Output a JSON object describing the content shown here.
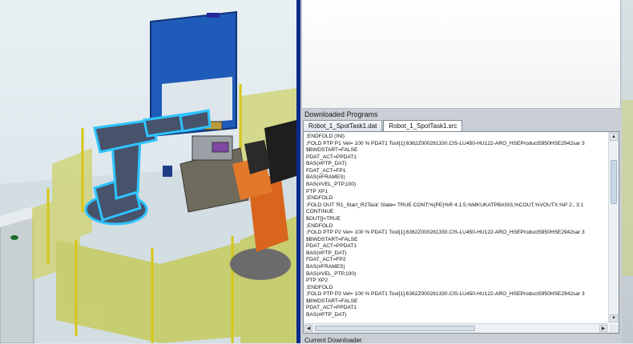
{
  "downloaded": {
    "title": "Downloaded Programs",
    "tabs": [
      "Robot_1_SpotTask1.dat",
      "Robot_1_SpotTask1.src"
    ],
    "active_tab": 1,
    "lines": [
      ";ENDFOLD (INI)",
      ";FOLD PTP P1 Vel= 100 % PDAT1 Tool[1]:6362Z000281330.CIS-LU450-HU122-ARO_HSEProduct5950HSE2942sar 3",
      "$BWDSTART=FALSE",
      "PDAT_ACT=PPDAT1",
      "BAS(#PTP_DAT)",
      "FDAT_ACT=FP1",
      "BAS(#FRAMES)",
      "BAS(#VEL_PTP,100)",
      "PTP XP1",
      ";ENDFOLD",
      ";FOLD OUT 'R1_Start_R2Task' State= TRUE CONT;%{PE}%R 4.1.5,%MKUKATPBASIS,%COUT,%VOUTX,%P 2:, 3:1",
      "CONTINUE",
      "$OUT[]=TRUE",
      ";ENDFOLD",
      ";FOLD PTP P2 Vel= 100 % PDAT1 Tool[1]:6362Z000281330.CIS-LU450-HU122-ARO_HSEProduct5950HSE2942sar 3",
      "$BWDSTART=FALSE",
      "PDAT_ACT=PPDAT1",
      "BAS(#PTP_DAT)",
      "FDAT_ACT=FP2",
      "BAS(#FRAMES)",
      "BAS(#VEL_PTP,100)",
      "PTP XP2",
      ";ENDFOLD",
      ";FOLD PTP P3 Vel= 100 % PDAT1 Tool[1]:6362Z000281330.CIS-LU450-HU122-ARO_HSEProduct5950HSE2942sar 3",
      "$BWDSTART=FALSE",
      "PDAT_ACT=PPDAT1",
      "BAS(#PTP_DAT)"
    ]
  },
  "current_downloader": {
    "title": "Current Downloader"
  },
  "icons": {
    "scroll_up": "▲",
    "scroll_down": "▼",
    "scroll_left": "◀",
    "scroll_right": "▶"
  },
  "colors": {
    "selection_highlight": "#2ec4ff",
    "panel_blue": "#1f5bb8",
    "robot_orange": "#d9641c",
    "fence_yellow": "#c8cc4a",
    "splitter": "#0b2a8a"
  }
}
